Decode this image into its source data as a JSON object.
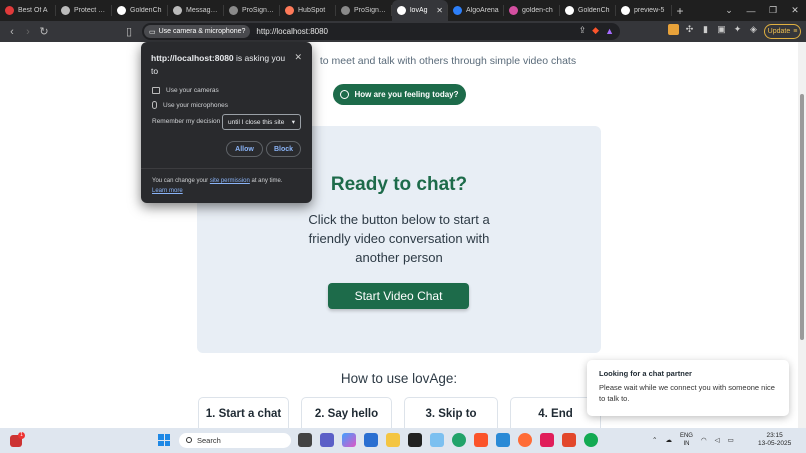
{
  "tabs": [
    {
      "title": "Best Of A",
      "color": "#e03a3a"
    },
    {
      "title": "Protect Ro",
      "color": "#bbbbbb"
    },
    {
      "title": "GoldenCh",
      "color": "#ffffff"
    },
    {
      "title": "Messaging",
      "color": "#bbbbbb"
    },
    {
      "title": "ProSign by",
      "color": "#8a8a8a"
    },
    {
      "title": "HubSpot",
      "color": "#ff7a59"
    },
    {
      "title": "ProSign by",
      "color": "#8a8a8a"
    },
    {
      "title": "lovAg",
      "color": "#ffffff",
      "active": true
    },
    {
      "title": "AlgoArena",
      "color": "#2d7ff9"
    },
    {
      "title": "golden-ch",
      "color": "#d44fa0"
    },
    {
      "title": "GoldenCh",
      "color": "#ffffff"
    },
    {
      "title": "preview-5",
      "color": "#ffffff"
    }
  ],
  "toolbar": {
    "permission_chip": "Use camera & microphone?",
    "url": "http://localhost:8080",
    "update_label": "Update"
  },
  "page": {
    "tagline": "to meet and talk with others through simple video chats",
    "mood_button": "How are you feeling today?",
    "card_title": "Ready to chat?",
    "card_body": "Click the button below to start a friendly video conversation with another person",
    "start_button": "Start Video Chat",
    "howto_title": "How to use lovAge:",
    "steps": [
      "1. Start a chat",
      "2. Say hello",
      "3. Skip to",
      "4. End"
    ]
  },
  "toast": {
    "title": "Looking for a chat partner",
    "body": "Please wait while we connect you with someone nice to talk to."
  },
  "permission_popup": {
    "host": "http://localhost:8080",
    "title_suffix": " is asking you to",
    "camera": "Use your cameras",
    "microphone": "Use your microphones",
    "remember_label": "Remember my decision",
    "remember_value": "until I close this site",
    "allow": "Allow",
    "block": "Block",
    "footer_prefix": "You can change your ",
    "footer_link": "site permission",
    "footer_suffix": " at any time.",
    "learn_more": "Learn more"
  },
  "taskbar": {
    "search_placeholder": "Search",
    "notification_count": "1",
    "lang_top": "ENG",
    "lang_bottom": "IN",
    "time": "23:15",
    "date": "13-05-2025"
  },
  "colors": {
    "brand_green": "#1d6b4a",
    "card_bg": "#e8eef5"
  }
}
